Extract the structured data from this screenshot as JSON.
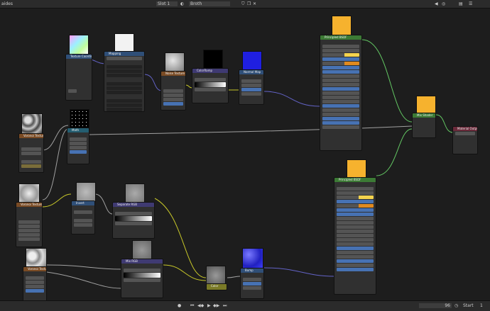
{
  "topbar": {
    "editor_suffix": "aides",
    "slot": "Slot 1",
    "material": "Broth"
  },
  "nodes": {
    "tex_coord": "Texture Coordinate",
    "mapping": "Mapping",
    "noise_texture": "Noise Texture",
    "color_ramp_1": "ColorRamp",
    "normal_map": "Normal Map",
    "principled_1": "Principled BSDF",
    "mix_shader": "Mix Shader",
    "material_output": "Material Output",
    "voronoi_1": "Voronoi Texture",
    "math": "Math",
    "voronoi_2": "Voronoi Texture",
    "voronoi_3": "Voronoi Texture",
    "invert": "Invert",
    "separate_rgb": "Separate RGB",
    "mix_rgb": "Mix RGB",
    "bump": "Bump",
    "principled_2": "Principled BSDF",
    "reroute": "Color"
  },
  "bottombar": {
    "frame": "96",
    "start_label": "Start",
    "start_value": "1"
  },
  "colors": {
    "shader_socket": "#63c763",
    "color_socket": "#c7c729",
    "vector_socket": "#6363c7",
    "float_socket": "#a1a1a1",
    "orange_preview": "#f6b22e",
    "blue_preview": "#1f1fe0"
  }
}
